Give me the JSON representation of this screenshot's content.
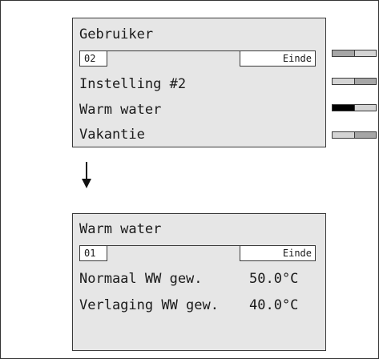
{
  "screen_user": {
    "title": "Gebruiker",
    "field_number": "02",
    "end_label": "Einde",
    "items": [
      {
        "label": "Instelling #2"
      },
      {
        "label": "Warm water"
      },
      {
        "label": "Vakantie"
      }
    ]
  },
  "toggles": [
    {
      "state": "right-on"
    },
    {
      "state": "right-on"
    },
    {
      "state": "left-active"
    },
    {
      "state": "right-on"
    }
  ],
  "flow_arrow": {
    "direction": "down"
  },
  "screen_hot_water": {
    "title": "Warm water",
    "field_number": "01",
    "end_label": "Einde",
    "settings": [
      {
        "label": "Normaal WW gew.",
        "value": "50.0°C"
      },
      {
        "label": "Verlaging WW gew.",
        "value": "40.0°C"
      }
    ]
  }
}
